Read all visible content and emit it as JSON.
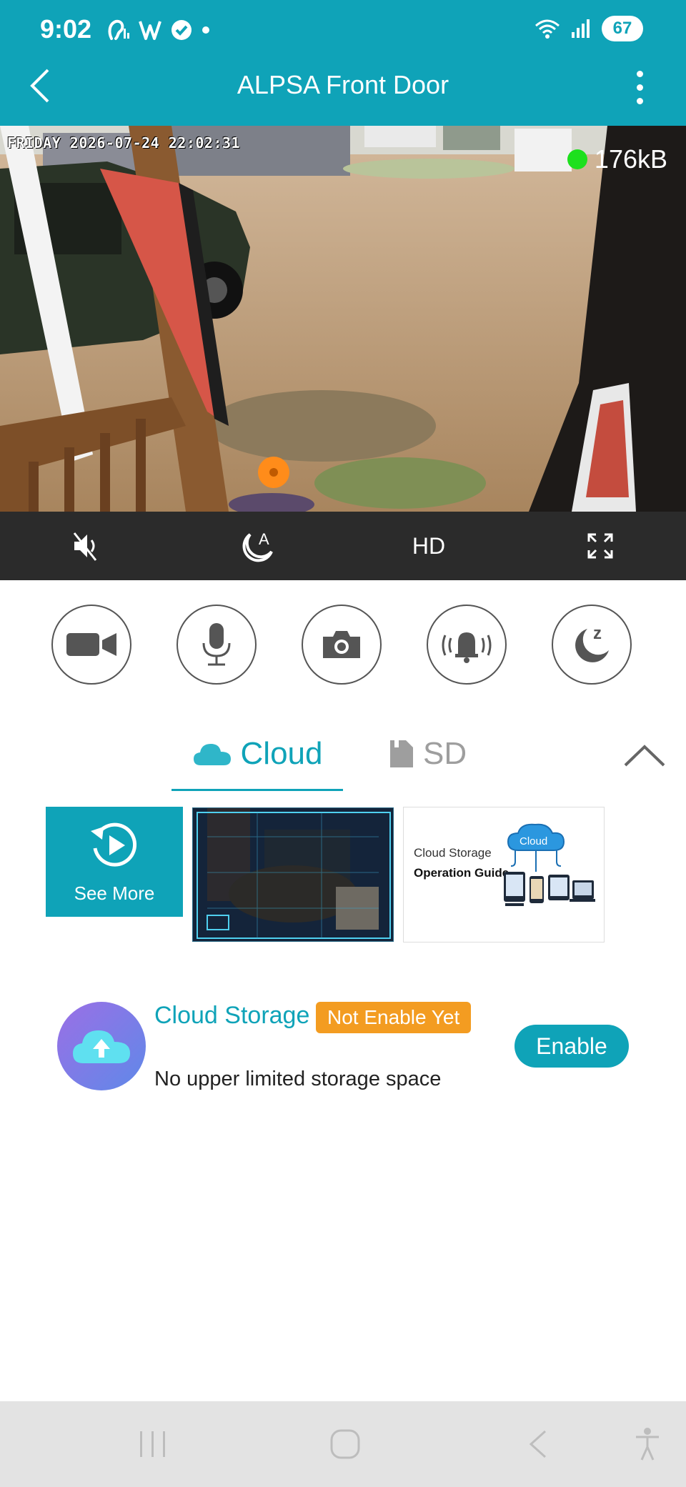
{
  "status_bar": {
    "time": "9:02",
    "battery": "67"
  },
  "header": {
    "title": "ALPSA Front Door"
  },
  "video": {
    "timestamp": "FRIDAY 2026-07-24 22:02:31",
    "bitrate": "176kB",
    "live_color": "#1de01d"
  },
  "controls": {
    "quality": "HD"
  },
  "tabs": {
    "cloud": "Cloud",
    "sd": "SD"
  },
  "thumbnails": {
    "see_more": "See More",
    "guide_line1": "Cloud Storage",
    "guide_line2": "Operation Guide",
    "guide_cloud": "Cloud"
  },
  "promo": {
    "title": "Cloud Storage",
    "badge": "Not Enable Yet",
    "description": "No upper limited storage space",
    "enable_label": "Enable"
  },
  "colors": {
    "accent": "#0fa3b8",
    "badge": "#f39c21"
  }
}
